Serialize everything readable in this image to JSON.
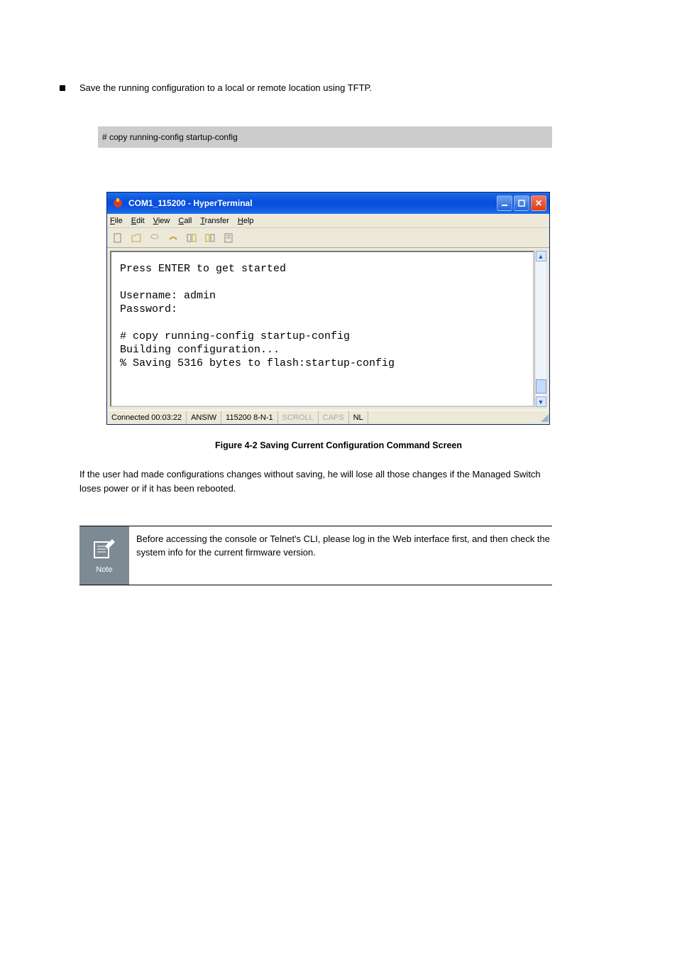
{
  "saveLine": "Save the running configuration to a local or remote location using TFTP.",
  "cmd": "# copy running-config startup-config",
  "window": {
    "title": "COM1_115200 - HyperTerminal",
    "menus": {
      "file": "File",
      "edit": "Edit",
      "view": "View",
      "call": "Call",
      "transfer": "Transfer",
      "help": "Help"
    },
    "terminalText": "Press ENTER to get started\n\nUsername: admin\nPassword:\n\n# copy running-config startup-config\nBuilding configuration...\n% Saving 5316 bytes to flash:startup-config",
    "status": {
      "connected": "Connected 00:03:22",
      "enc": "ANSIW",
      "set": "115200 8-N-1",
      "scroll": "SCROLL",
      "caps": "CAPS",
      "nl": "NL"
    }
  },
  "figCaption": "Figure 4-2 Saving Current Configuration Command Screen",
  "paragraph": "If the user had made configurations changes without saving, he will lose all those changes if the Managed Switch loses power or if it has been rebooted.",
  "noteIconLabel": "Note",
  "noteText": "Before accessing the console or Telnet's CLI, please log in the Web interface first, and then check the system info for the current firmware version."
}
